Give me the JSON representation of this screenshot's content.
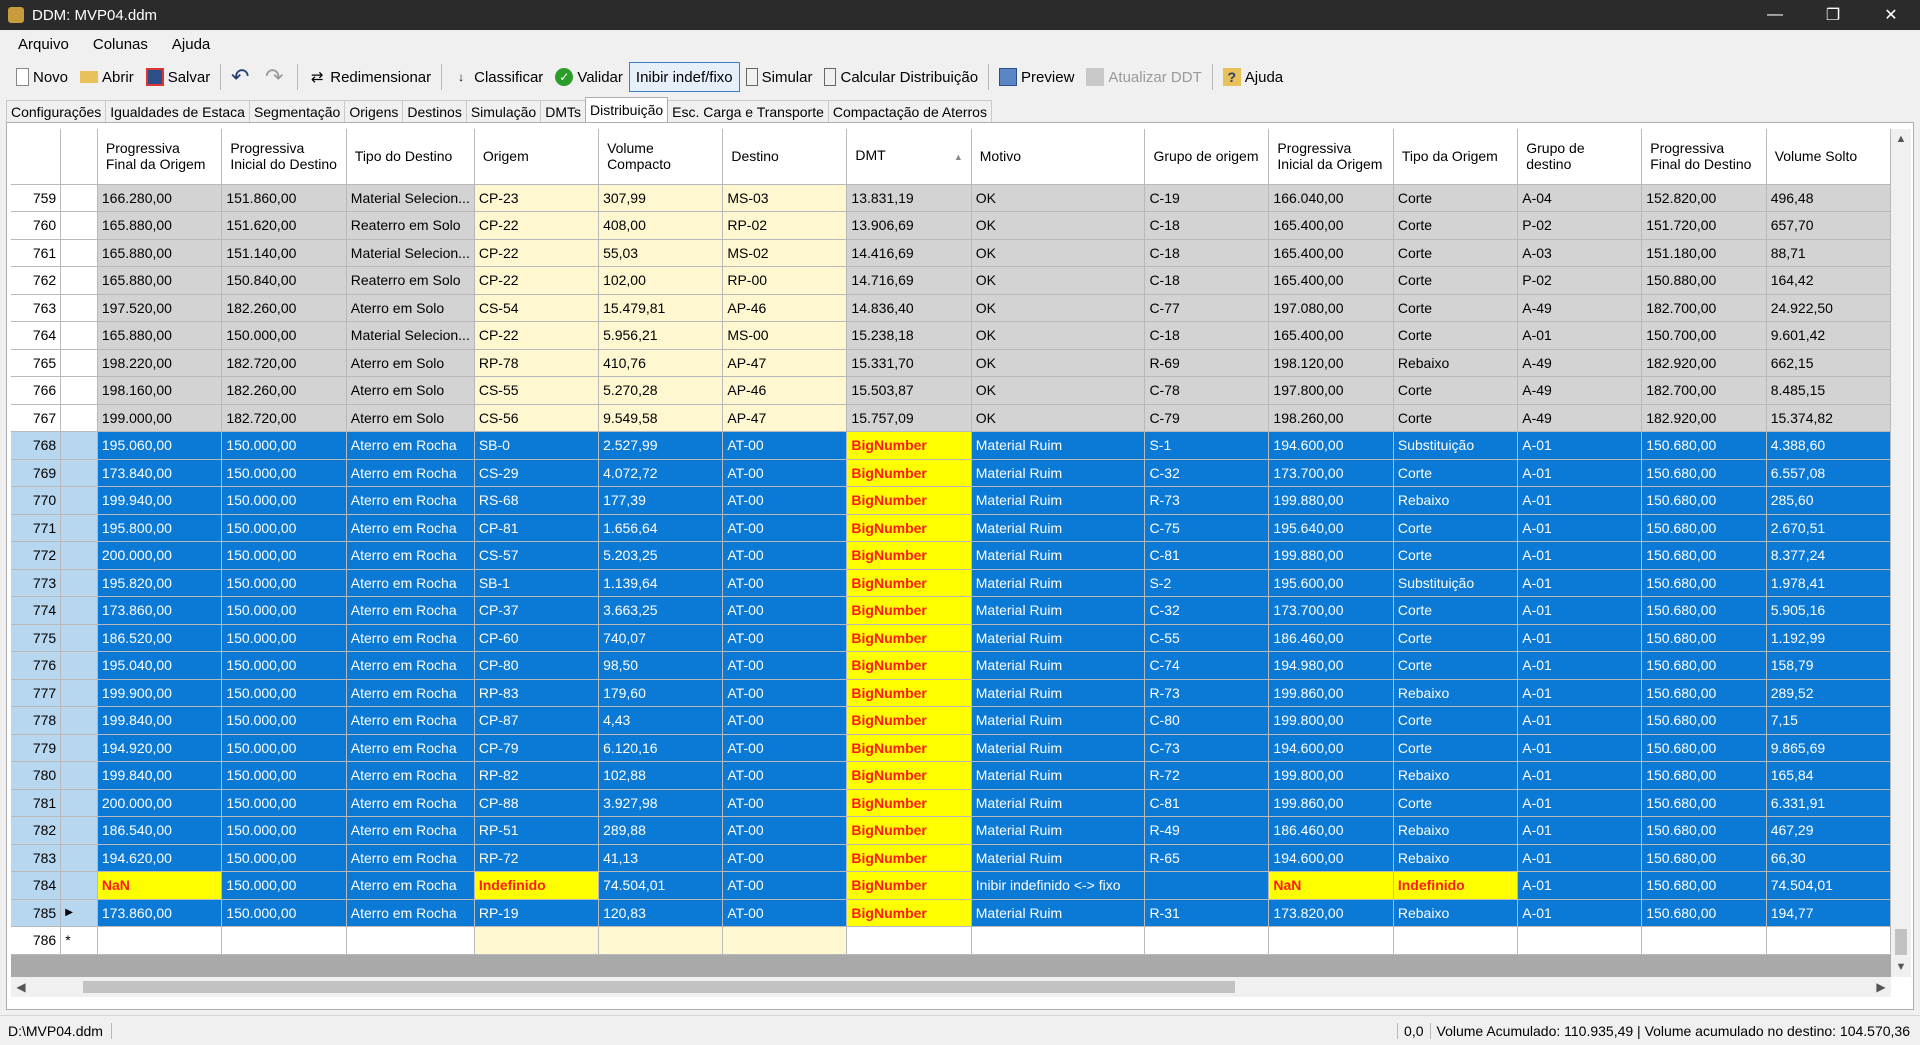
{
  "window": {
    "title": "DDM: MVP04.ddm",
    "min_icon": "minimize-icon",
    "max_icon": "restore-icon",
    "close_icon": "close-icon"
  },
  "menu": [
    "Arquivo",
    "Colunas",
    "Ajuda"
  ],
  "toolbar": {
    "novo": "Novo",
    "abrir": "Abrir",
    "salvar": "Salvar",
    "redimensionar": "Redimensionar",
    "classificar": "Classificar",
    "validar": "Validar",
    "inibir": "Inibir indef/fixo",
    "simular": "Simular",
    "calcular": "Calcular Distribuição",
    "preview": "Preview",
    "atualizar": "Atualizar DDT",
    "ajuda": "Ajuda"
  },
  "tabs": [
    "Configurações",
    "Igualdades de Estaca",
    "Segmentação",
    "Origens",
    "Destinos",
    "Simulação",
    "DMTs",
    "Distribuição",
    "Esc. Carga e Transporte",
    "Compactação de Aterros"
  ],
  "columns": [
    "Progressiva Final da Origem",
    "Progressiva Inicial do Destino",
    "Tipo do Destino",
    "Origem",
    "Volume Compacto",
    "Destino",
    "DMT",
    "Motivo",
    "Grupo de origem",
    "Progressiva Inicial da Origem",
    "Tipo da Origem",
    "Grupo de destino",
    "Progressiva Final do Destino",
    "Volume Solto"
  ],
  "rows": [
    {
      "n": "759",
      "s": "gray",
      "c": [
        "166.280,00",
        "151.860,00",
        "Material Selecion...",
        "CP-23",
        "307,99",
        "MS-03",
        "13.831,19",
        "OK",
        "C-19",
        "166.040,00",
        "Corte",
        "A-04",
        "152.820,00",
        "496,48"
      ]
    },
    {
      "n": "760",
      "s": "gray",
      "c": [
        "165.880,00",
        "151.620,00",
        "Reaterro em Solo",
        "CP-22",
        "408,00",
        "RP-02",
        "13.906,69",
        "OK",
        "C-18",
        "165.400,00",
        "Corte",
        "P-02",
        "151.720,00",
        "657,70"
      ]
    },
    {
      "n": "761",
      "s": "gray",
      "c": [
        "165.880,00",
        "151.140,00",
        "Material Selecion...",
        "CP-22",
        "55,03",
        "MS-02",
        "14.416,69",
        "OK",
        "C-18",
        "165.400,00",
        "Corte",
        "A-03",
        "151.180,00",
        "88,71"
      ]
    },
    {
      "n": "762",
      "s": "gray",
      "c": [
        "165.880,00",
        "150.840,00",
        "Reaterro em Solo",
        "CP-22",
        "102,00",
        "RP-00",
        "14.716,69",
        "OK",
        "C-18",
        "165.400,00",
        "Corte",
        "P-02",
        "150.880,00",
        "164,42"
      ]
    },
    {
      "n": "763",
      "s": "gray",
      "c": [
        "197.520,00",
        "182.260,00",
        "Aterro em Solo",
        "CS-54",
        "15.479,81",
        "AP-46",
        "14.836,40",
        "OK",
        "C-77",
        "197.080,00",
        "Corte",
        "A-49",
        "182.700,00",
        "24.922,50"
      ]
    },
    {
      "n": "764",
      "s": "gray",
      "c": [
        "165.880,00",
        "150.000,00",
        "Material Selecion...",
        "CP-22",
        "5.956,21",
        "MS-00",
        "15.238,18",
        "OK",
        "C-18",
        "165.400,00",
        "Corte",
        "A-01",
        "150.700,00",
        "9.601,42"
      ]
    },
    {
      "n": "765",
      "s": "gray",
      "c": [
        "198.220,00",
        "182.720,00",
        "Aterro em Solo",
        "RP-78",
        "410,76",
        "AP-47",
        "15.331,70",
        "OK",
        "R-69",
        "198.120,00",
        "Rebaixo",
        "A-49",
        "182.920,00",
        "662,15"
      ]
    },
    {
      "n": "766",
      "s": "gray",
      "c": [
        "198.160,00",
        "182.260,00",
        "Aterro em Solo",
        "CS-55",
        "5.270,28",
        "AP-46",
        "15.503,87",
        "OK",
        "C-78",
        "197.800,00",
        "Corte",
        "A-49",
        "182.700,00",
        "8.485,15"
      ]
    },
    {
      "n": "767",
      "s": "gray",
      "c": [
        "199.000,00",
        "182.720,00",
        "Aterro em Solo",
        "CS-56",
        "9.549,58",
        "AP-47",
        "15.757,09",
        "OK",
        "C-79",
        "198.260,00",
        "Corte",
        "A-49",
        "182.920,00",
        "15.374,82"
      ]
    },
    {
      "n": "768",
      "s": "blue",
      "c": [
        "195.060,00",
        "150.000,00",
        "Aterro em Rocha",
        "SB-0",
        "2.527,99",
        "AT-00",
        "BigNumber",
        "Material Ruim",
        "S-1",
        "194.600,00",
        "Substituição",
        "A-01",
        "150.680,00",
        "4.388,60"
      ]
    },
    {
      "n": "769",
      "s": "blue",
      "c": [
        "173.840,00",
        "150.000,00",
        "Aterro em Rocha",
        "CS-29",
        "4.072,72",
        "AT-00",
        "BigNumber",
        "Material Ruim",
        "C-32",
        "173.700,00",
        "Corte",
        "A-01",
        "150.680,00",
        "6.557,08"
      ]
    },
    {
      "n": "770",
      "s": "blue",
      "c": [
        "199.940,00",
        "150.000,00",
        "Aterro em Rocha",
        "RS-68",
        "177,39",
        "AT-00",
        "BigNumber",
        "Material Ruim",
        "R-73",
        "199.880,00",
        "Rebaixo",
        "A-01",
        "150.680,00",
        "285,60"
      ]
    },
    {
      "n": "771",
      "s": "blue",
      "c": [
        "195.800,00",
        "150.000,00",
        "Aterro em Rocha",
        "CP-81",
        "1.656,64",
        "AT-00",
        "BigNumber",
        "Material Ruim",
        "C-75",
        "195.640,00",
        "Corte",
        "A-01",
        "150.680,00",
        "2.670,51"
      ]
    },
    {
      "n": "772",
      "s": "blue",
      "c": [
        "200.000,00",
        "150.000,00",
        "Aterro em Rocha",
        "CS-57",
        "5.203,25",
        "AT-00",
        "BigNumber",
        "Material Ruim",
        "C-81",
        "199.880,00",
        "Corte",
        "A-01",
        "150.680,00",
        "8.377,24"
      ]
    },
    {
      "n": "773",
      "s": "blue",
      "c": [
        "195.820,00",
        "150.000,00",
        "Aterro em Rocha",
        "SB-1",
        "1.139,64",
        "AT-00",
        "BigNumber",
        "Material Ruim",
        "S-2",
        "195.600,00",
        "Substituição",
        "A-01",
        "150.680,00",
        "1.978,41"
      ]
    },
    {
      "n": "774",
      "s": "blue",
      "c": [
        "173.860,00",
        "150.000,00",
        "Aterro em Rocha",
        "CP-37",
        "3.663,25",
        "AT-00",
        "BigNumber",
        "Material Ruim",
        "C-32",
        "173.700,00",
        "Corte",
        "A-01",
        "150.680,00",
        "5.905,16"
      ]
    },
    {
      "n": "775",
      "s": "blue",
      "c": [
        "186.520,00",
        "150.000,00",
        "Aterro em Rocha",
        "CP-60",
        "740,07",
        "AT-00",
        "BigNumber",
        "Material Ruim",
        "C-55",
        "186.460,00",
        "Corte",
        "A-01",
        "150.680,00",
        "1.192,99"
      ]
    },
    {
      "n": "776",
      "s": "blue",
      "c": [
        "195.040,00",
        "150.000,00",
        "Aterro em Rocha",
        "CP-80",
        "98,50",
        "AT-00",
        "BigNumber",
        "Material Ruim",
        "C-74",
        "194.980,00",
        "Corte",
        "A-01",
        "150.680,00",
        "158,79"
      ]
    },
    {
      "n": "777",
      "s": "blue",
      "c": [
        "199.900,00",
        "150.000,00",
        "Aterro em Rocha",
        "RP-83",
        "179,60",
        "AT-00",
        "BigNumber",
        "Material Ruim",
        "R-73",
        "199.860,00",
        "Rebaixo",
        "A-01",
        "150.680,00",
        "289,52"
      ]
    },
    {
      "n": "778",
      "s": "blue",
      "c": [
        "199.840,00",
        "150.000,00",
        "Aterro em Rocha",
        "CP-87",
        "4,43",
        "AT-00",
        "BigNumber",
        "Material Ruim",
        "C-80",
        "199.800,00",
        "Corte",
        "A-01",
        "150.680,00",
        "7,15"
      ]
    },
    {
      "n": "779",
      "s": "blue",
      "c": [
        "194.920,00",
        "150.000,00",
        "Aterro em Rocha",
        "CP-79",
        "6.120,16",
        "AT-00",
        "BigNumber",
        "Material Ruim",
        "C-73",
        "194.600,00",
        "Corte",
        "A-01",
        "150.680,00",
        "9.865,69"
      ]
    },
    {
      "n": "780",
      "s": "blue",
      "c": [
        "199.840,00",
        "150.000,00",
        "Aterro em Rocha",
        "RP-82",
        "102,88",
        "AT-00",
        "BigNumber",
        "Material Ruim",
        "R-72",
        "199.800,00",
        "Rebaixo",
        "A-01",
        "150.680,00",
        "165,84"
      ]
    },
    {
      "n": "781",
      "s": "blue",
      "c": [
        "200.000,00",
        "150.000,00",
        "Aterro em Rocha",
        "CP-88",
        "3.927,98",
        "AT-00",
        "BigNumber",
        "Material Ruim",
        "C-81",
        "199.860,00",
        "Corte",
        "A-01",
        "150.680,00",
        "6.331,91"
      ]
    },
    {
      "n": "782",
      "s": "blue",
      "c": [
        "186.540,00",
        "150.000,00",
        "Aterro em Rocha",
        "RP-51",
        "289,88",
        "AT-00",
        "BigNumber",
        "Material Ruim",
        "R-49",
        "186.460,00",
        "Rebaixo",
        "A-01",
        "150.680,00",
        "467,29"
      ]
    },
    {
      "n": "783",
      "s": "blue",
      "c": [
        "194.620,00",
        "150.000,00",
        "Aterro em Rocha",
        "RP-72",
        "41,13",
        "AT-00",
        "BigNumber",
        "Material Ruim",
        "R-65",
        "194.600,00",
        "Rebaixo",
        "A-01",
        "150.680,00",
        "66,30"
      ]
    },
    {
      "n": "784",
      "s": "blue",
      "c": [
        "NaN",
        "150.000,00",
        "Aterro em Rocha",
        "Indefinido",
        "74.504,01",
        "AT-00",
        "BigNumber",
        "Inibir indefinido <-> fixo",
        "",
        "NaN",
        "Indefinido",
        "A-01",
        "150.680,00",
        "74.504,01"
      ]
    },
    {
      "n": "785",
      "s": "blue",
      "c": [
        "173.860,00",
        "150.000,00",
        "Aterro em Rocha",
        "RP-19",
        "120,83",
        "AT-00",
        "BigNumber",
        "Material Ruim",
        "R-31",
        "173.820,00",
        "Rebaixo",
        "A-01",
        "150.680,00",
        "194,77"
      ]
    }
  ],
  "new_row": "786",
  "status": {
    "path": "D:\\MVP04.ddm",
    "coords": "0,0",
    "volume": "Volume Acumulado: 110.935,49 | Volume acumulado no destino: 104.570,36"
  },
  "colors": {
    "selection": "#0a7ad6",
    "warning_bg": "#ffff00",
    "warning_text": "#ff1a1a"
  }
}
